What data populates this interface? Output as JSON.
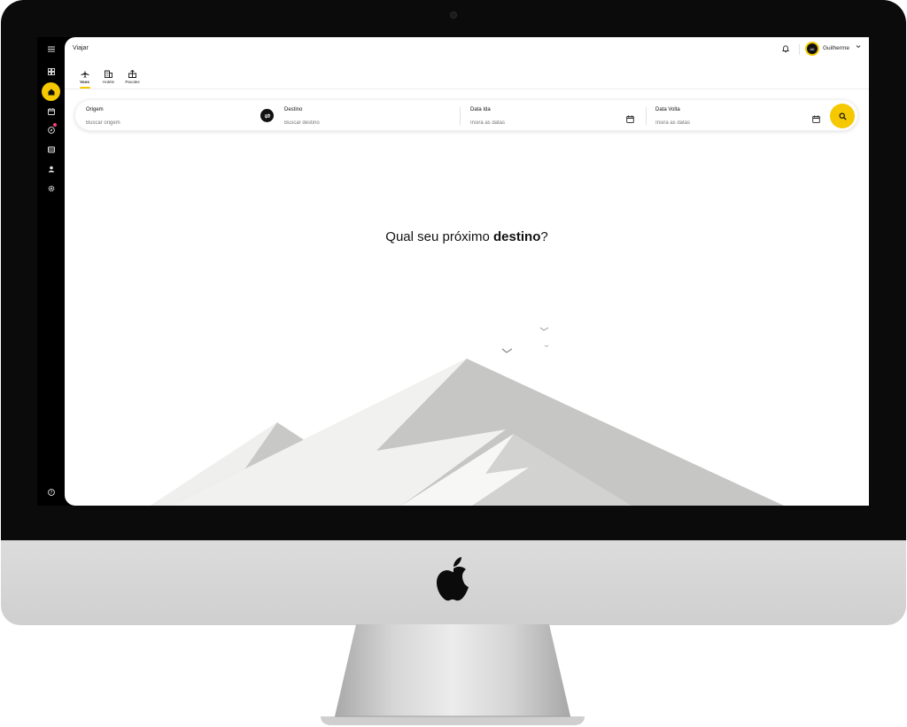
{
  "app": {
    "title": "Viajar"
  },
  "user": {
    "initials": "AK",
    "name": "Guilherme"
  },
  "sidebar": {
    "items": [
      {
        "icon": "menu-icon"
      },
      {
        "icon": "dashboard-icon"
      },
      {
        "icon": "home-icon",
        "active": true
      },
      {
        "icon": "calendar-icon"
      },
      {
        "icon": "compass-icon",
        "badge": true
      },
      {
        "icon": "card-icon"
      },
      {
        "icon": "user-icon"
      },
      {
        "icon": "settings-icon"
      },
      {
        "icon": "help-icon"
      }
    ]
  },
  "tabs": [
    {
      "label": "Voos",
      "icon": "plane-icon",
      "active": true
    },
    {
      "label": "Hotéis",
      "icon": "hotel-icon"
    },
    {
      "label": "Pacotes",
      "icon": "package-icon"
    }
  ],
  "search": {
    "origin": {
      "label": "Origem",
      "placeholder": "Buscar origem"
    },
    "destination": {
      "label": "Destino",
      "placeholder": "Buscar destino"
    },
    "departure": {
      "label": "Data Ida",
      "placeholder": "Insira as datas"
    },
    "return": {
      "label": "Data Volta",
      "placeholder": "Insira as datas"
    }
  },
  "headline": {
    "prefix": "Qual seu próximo ",
    "bold": "destino",
    "suffix": "?"
  },
  "colors": {
    "accent": "#f6c800",
    "sidebar": "#000000",
    "badge": "#ff3b7f"
  }
}
